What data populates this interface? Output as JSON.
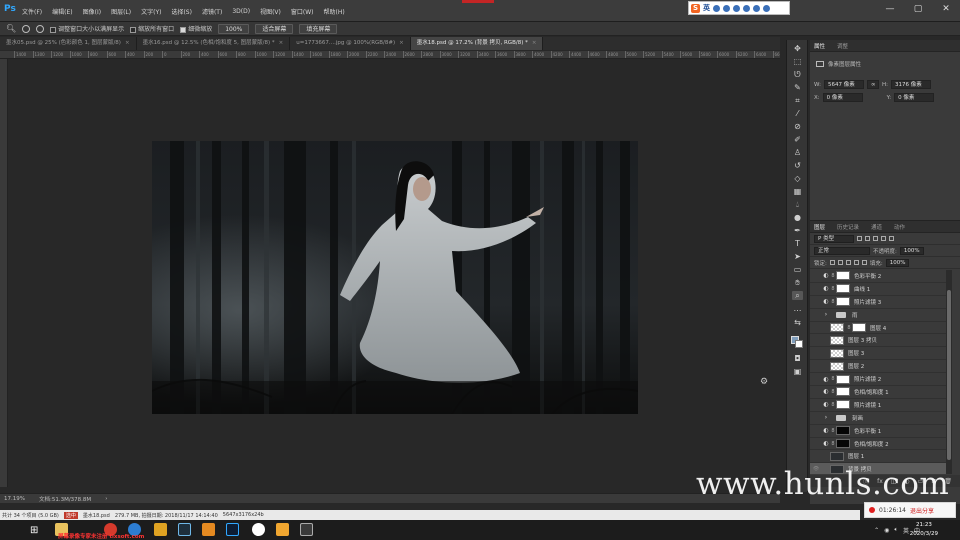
{
  "app": {
    "logo": "Ps",
    "menu": [
      "文件(F)",
      "编辑(E)",
      "图像(I)",
      "图层(L)",
      "文字(Y)",
      "选择(S)",
      "滤镜(T)",
      "3D(D)",
      "视图(V)",
      "窗口(W)",
      "帮助(H)"
    ]
  },
  "ime": {
    "logo": "S",
    "lang": "英"
  },
  "window_controls": [
    "—",
    "▢",
    "✕"
  ],
  "options_bar": {
    "resize_label": "调整窗口大小以满屏显示",
    "all_windows_label": "缩放所有窗口",
    "scrubby_label": "细微缩放",
    "zoom_value": "100%",
    "fit_screen": "适合屏幕",
    "fill_screen": "填充屏幕"
  },
  "tabs": [
    {
      "label": "墨水05.psd @ 25% (色彩颜色 1, 图层蒙版/8)",
      "active": false
    },
    {
      "label": "墨水16.psd @ 12.5% (色相/饱和度 5, 图层蒙版/8) *",
      "active": false
    },
    {
      "label": "u=1773667....jpg @ 100%(RGB/8#)",
      "active": false
    },
    {
      "label": "墨水18.psd @ 17.2% (背景 拷贝, RGB/8) *",
      "active": true
    }
  ],
  "ruler_ticks": [
    "1400",
    "1300",
    "1200",
    "1000",
    "800",
    "600",
    "400",
    "200",
    "0",
    "200",
    "400",
    "600",
    "800",
    "1000",
    "1200",
    "1400",
    "1600",
    "1800",
    "2000",
    "2200",
    "2400",
    "2600",
    "2800",
    "3000",
    "3200",
    "3400",
    "3600",
    "3800",
    "4000",
    "4200",
    "4400",
    "4600",
    "4800",
    "5000",
    "5200",
    "5400",
    "5600",
    "5800",
    "6000",
    "6200",
    "6400",
    "6600",
    "6800"
  ],
  "status": {
    "zoom": "17.19%",
    "doc": "文档:51.3M/378.8M"
  },
  "properties": {
    "tabs": [
      "属性",
      "调整"
    ],
    "title": "像素图层属性",
    "w_label": "W:",
    "w_value": "5647 像素",
    "h_label": "H:",
    "h_value": "3176 像素",
    "x_label": "X:",
    "x_value": "0 像素",
    "y_label": "Y:",
    "y_value": "0 像素"
  },
  "layers_panel": {
    "tabs": [
      "图层",
      "历史记录",
      "通道",
      "动作"
    ],
    "filter": "P 类型",
    "blend_mode": "正常",
    "opacity_label": "不透明度:",
    "opacity_value": "100%",
    "lock_label": "锁定:",
    "fill_label": "填充:",
    "fill_value": "100%",
    "layers": [
      {
        "name": "色彩平衡 2",
        "thumb": "white",
        "adj": "◐",
        "link": "8",
        "sel": false
      },
      {
        "name": "曲线 1",
        "thumb": "white",
        "adj": "◐",
        "link": "8",
        "sel": false
      },
      {
        "name": "照片滤镜 3",
        "thumb": "white",
        "adj": "◐",
        "link": "8",
        "sel": false
      },
      {
        "name": "雨",
        "thumb": "folder",
        "adj": "›",
        "link": "",
        "sel": false
      },
      {
        "name": "图层 4",
        "thumb": "white",
        "adj": "",
        "link": "8",
        "sel": false,
        "checker": true
      },
      {
        "name": "图层 3 拷贝",
        "thumb": "check",
        "adj": "",
        "link": "",
        "sel": false
      },
      {
        "name": "图层 3",
        "thumb": "check",
        "adj": "",
        "link": "",
        "sel": false
      },
      {
        "name": "图层 2",
        "thumb": "check",
        "adj": "",
        "link": "",
        "sel": false
      },
      {
        "name": "照片滤镜 2",
        "thumb": "white",
        "adj": "◐",
        "link": "8",
        "sel": false
      },
      {
        "name": "色相/饱和度 1",
        "thumb": "white",
        "adj": "◐",
        "link": "8",
        "sel": false
      },
      {
        "name": "照片滤镜 1",
        "thumb": "white",
        "adj": "◐",
        "link": "8",
        "sel": false
      },
      {
        "name": "刻画",
        "thumb": "folder",
        "adj": "›",
        "link": "",
        "sel": false
      },
      {
        "name": "色彩平衡 1",
        "thumb": "black",
        "adj": "◐",
        "link": "8",
        "sel": false
      },
      {
        "name": "色相/饱和度 2",
        "thumb": "black",
        "adj": "◐",
        "link": "8",
        "sel": false
      },
      {
        "name": "图层 1",
        "thumb": "photo",
        "adj": "",
        "link": "",
        "sel": false
      },
      {
        "name": "背景 拷贝",
        "thumb": "photo",
        "adj": "",
        "link": "",
        "sel": true
      }
    ],
    "footer_icons": [
      "ⓕ",
      "fx",
      "◫",
      "◐",
      "▭",
      "⊞",
      "🗑"
    ]
  },
  "watermark": "www.hunls.com",
  "recording": {
    "time": "01:26:14",
    "stop_label": "退出分享"
  },
  "explorer_strip": {
    "count": "共计 34 个项目 (5.0 GB)",
    "selected": "选中",
    "file": "墨水18.psd",
    "size": "279.7 MB, 拍摄日期: 2018/11/17 14:14:40",
    "dims": "5647x3176x24b"
  },
  "taskbar": {
    "banner": "屏幕录像专家未注册 tlxsoft.com",
    "time": "21:23",
    "date": "2020/3/29",
    "tray_lang": "英",
    "tray_ime": "中"
  },
  "colors": {
    "accent_blue": "#31a8ff",
    "foreground_swatch": "#7f9dbb",
    "record_red": "#e02020"
  }
}
